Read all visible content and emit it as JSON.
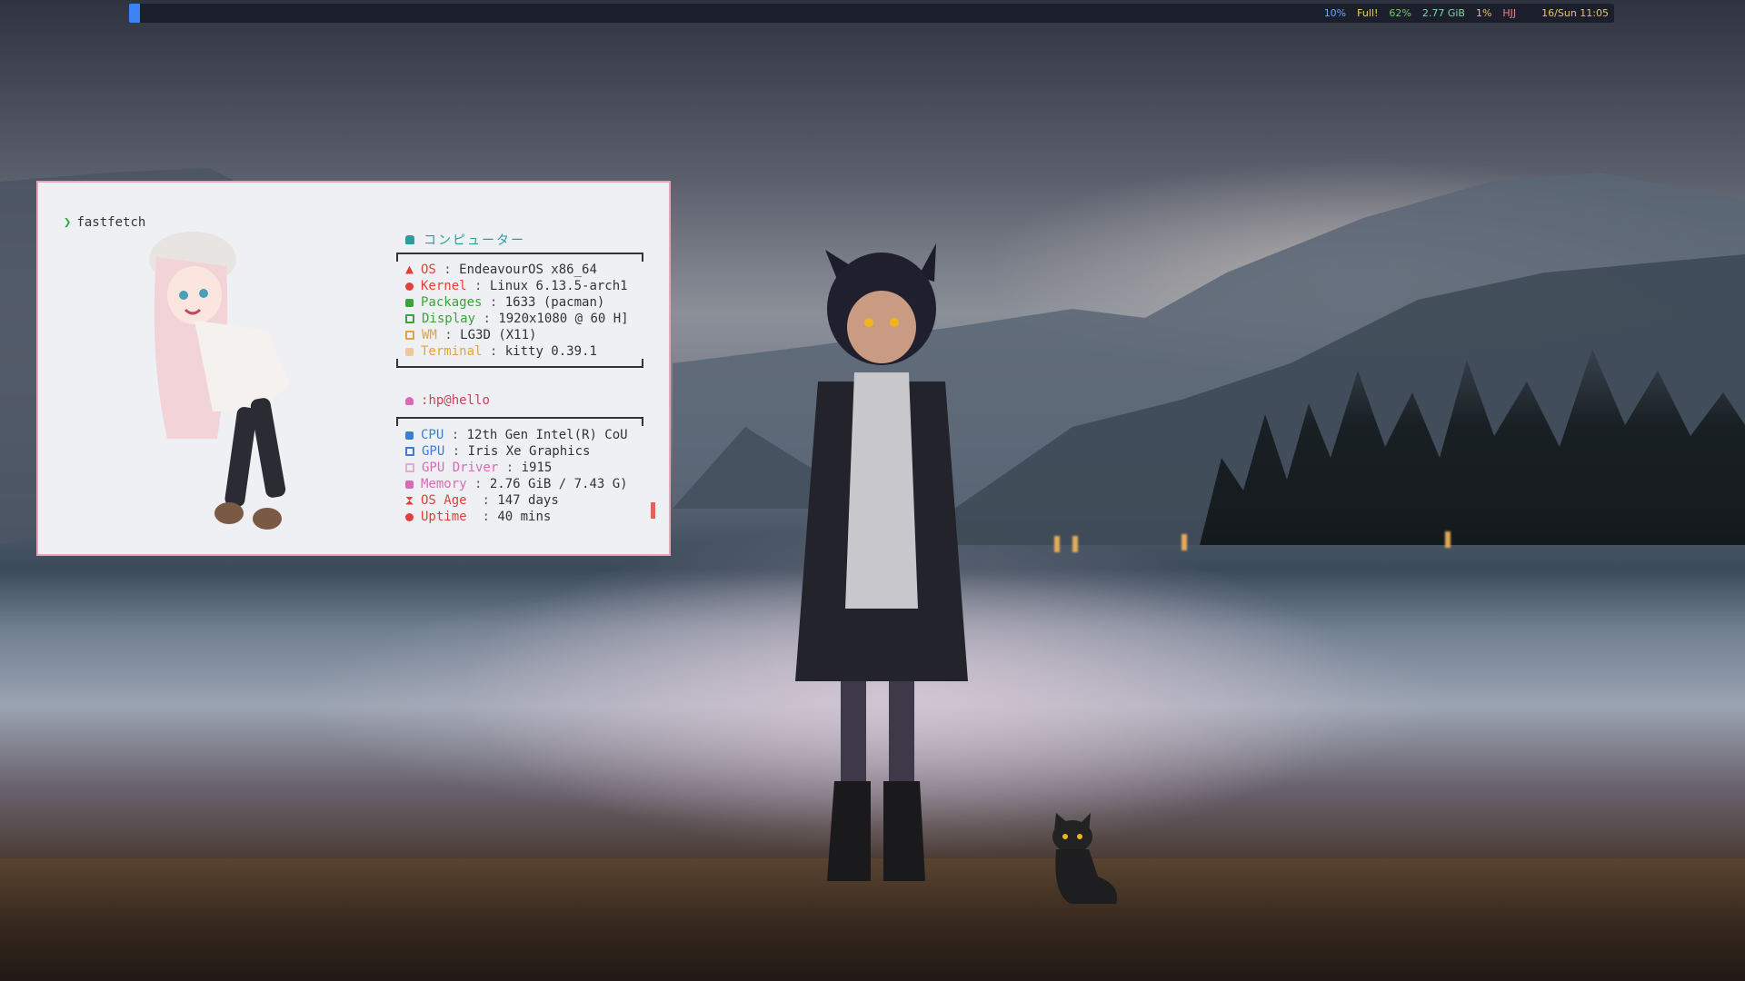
{
  "topbar": {
    "items": [
      {
        "text": "10%",
        "color": "#6aa7ff"
      },
      {
        "text": "Full!",
        "color": "#f0d264"
      },
      {
        "text": "62%",
        "color": "#6ccf5b"
      },
      {
        "text": "2.77 GiB",
        "color": "#7fd6a0"
      },
      {
        "text": "1%",
        "color": "#e8c36a"
      },
      {
        "text": "HJJ",
        "color": "#f07f7f"
      },
      {
        "text": "16/Sun 11:05",
        "color": "#e8c36a"
      }
    ]
  },
  "terminal": {
    "prompt_arrow": "❯",
    "command": "fastfetch",
    "header": "コンピューター",
    "system": [
      {
        "key": "OS",
        "value": "EndeavourOS x86_64",
        "color": "#e0413a",
        "icon": "endeavour-icon"
      },
      {
        "key": "Kernel",
        "value": "Linux 6.13.5-arch1",
        "color": "#e0413a",
        "icon": "kernel-icon"
      },
      {
        "key": "Packages",
        "value": "1633 (pacman)",
        "color": "#3aa43a",
        "icon": "package-icon"
      },
      {
        "key": "Display",
        "value": "1920x1080 @ 60 H]",
        "color": "#3aa43a",
        "icon": "display-icon"
      },
      {
        "key": "WM",
        "value": "LG3D (X11)",
        "color": "#e8a23a",
        "icon": "window-icon"
      },
      {
        "key": "Terminal",
        "value": "kitty 0.39.1",
        "color": "#e8a23a",
        "icon": "terminal-icon"
      }
    ],
    "user_label": ":",
    "user": "hp@hello",
    "hardware": [
      {
        "key": "CPU",
        "value": "12th Gen Intel(R) CoU",
        "color": "#3a7dd8",
        "icon": "cpu-icon"
      },
      {
        "key": "GPU",
        "value": "Iris Xe Graphics",
        "color": "#3a7dd8",
        "icon": "gpu-icon"
      },
      {
        "key": "GPU Driver",
        "value": "i915",
        "color": "#d86ab8",
        "icon": "driver-icon"
      },
      {
        "key": "Memory",
        "value": "2.76 GiB / 7.43 G)",
        "color": "#d86ab8",
        "icon": "memory-icon"
      },
      {
        "key": "OS Age ",
        "value": "147 days",
        "color": "#e0413a",
        "icon": "hourglass-icon"
      },
      {
        "key": "Uptime ",
        "value": "40 mins",
        "color": "#e0413a",
        "icon": "uptime-icon"
      }
    ],
    "colors": {
      "accent": "#2a9d9d",
      "border": "#e7a6b8",
      "background": "#eef0f4"
    }
  }
}
